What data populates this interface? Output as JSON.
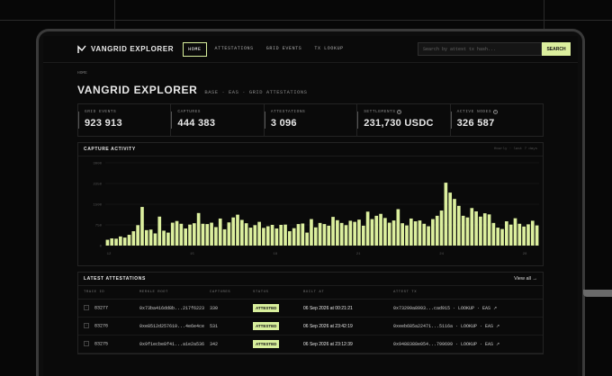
{
  "nav": {
    "brand": "VANGRID EXPLORER",
    "links": [
      "HOME",
      "ATTESTATIONS",
      "GRID EVENTS",
      "TX LOOKUP"
    ],
    "search_placeholder": "Search by attest tx hash...",
    "search_button": "SEARCH"
  },
  "breadcrumb": "HOME",
  "page": {
    "title": "VANGRID EXPLORER",
    "subtitle": "BASE · EAS · GRID ATTESTATIONS"
  },
  "stats": [
    {
      "label": "GRID EVENTS",
      "value": "923 913"
    },
    {
      "label": "CAPTURES",
      "value": "444 383"
    },
    {
      "label": "ATTESTATIONS",
      "value": "3 096"
    },
    {
      "label": "SETTLEMENTS",
      "value": "231,730 USDC"
    },
    {
      "label": "ACTIVE NODES",
      "value": "326 587"
    }
  ],
  "chart_panel": {
    "title": "CAPTURE ACTIVITY",
    "meta": "Hourly · last 7 days"
  },
  "chart_data": {
    "type": "bar",
    "title": "CAPTURE ACTIVITY",
    "ylim": [
      0,
      3000
    ],
    "y_ticks": [
      0,
      750,
      1500,
      2250,
      3000
    ],
    "x_ticks": [
      "12",
      "15",
      "18",
      "21",
      "24",
      "28"
    ],
    "values": [
      210,
      260,
      250,
      330,
      290,
      390,
      520,
      740,
      1400,
      560,
      580,
      440,
      1050,
      540,
      470,
      830,
      890,
      790,
      620,
      760,
      810,
      1180,
      790,
      780,
      830,
      670,
      980,
      590,
      840,
      1020,
      1120,
      930,
      810,
      650,
      740,
      860,
      640,
      700,
      750,
      620,
      750,
      760,
      520,
      630,
      780,
      800,
      470,
      960,
      660,
      820,
      780,
      720,
      1040,
      920,
      820,
      740,
      900,
      860,
      940,
      720,
      1230,
      960,
      1080,
      1150,
      1000,
      830,
      910,
      1320,
      810,
      730,
      980,
      880,
      910,
      790,
      700,
      960,
      1080,
      1270,
      2280,
      1920,
      1690,
      1440,
      1080,
      1020,
      1360,
      1240,
      1050,
      1170,
      1130,
      820,
      650,
      600,
      880,
      760,
      990,
      790,
      690,
      770,
      900,
      730
    ]
  },
  "table": {
    "title": "LATEST ATTESTATIONS",
    "view_all": "View all →",
    "columns": [
      "TRACE ID",
      "MERKLE ROOT",
      "CAPTURES",
      "STATUS",
      "BUILT AT",
      "ATTEST TX"
    ],
    "rows": [
      {
        "id": "83277",
        "root": "0x73ba416dd8b...217f6223",
        "captures": "330",
        "status": "ATTESTED",
        "built": "06 Sep 2026 at 00:21:21",
        "tx": "0x73299a8993...cad915 · LOOKUP · EAS ↗"
      },
      {
        "id": "83276",
        "root": "0xe8512d257610...4e6e4ce",
        "captures": "531",
        "status": "ATTESTED",
        "built": "06 Sep 2026 at 23:42:19",
        "tx": "0xeeb685a22471...5116a · LOOKUP · EAS ↗"
      },
      {
        "id": "83275",
        "root": "0x9f1ecbe8f41...a1e2a536",
        "captures": "342",
        "status": "ATTESTED",
        "built": "06 Sep 2026 at 23:12:39",
        "tx": "0x9488388e054...799699 · LOOKUP · EAS ↗"
      }
    ]
  },
  "colors": {
    "accent": "#d8ef9c",
    "background": "#0a0a0a"
  }
}
